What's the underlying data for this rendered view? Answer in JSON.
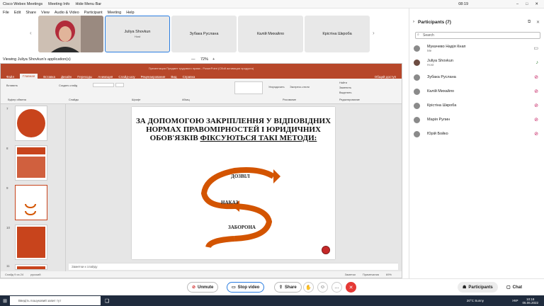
{
  "titlebar": {
    "app": "Cisco Webex Meetings",
    "info": "Meeting Info",
    "hide_menu": "Hide Menu Bar",
    "time": "08:19"
  },
  "menu": [
    "File",
    "Edit",
    "Share",
    "View",
    "Audio & Video",
    "Participant",
    "Meeting",
    "Help"
  ],
  "tiles": [
    {
      "name": "Juliya Shovkun",
      "role": "Host"
    },
    {
      "name": "Зубака Руслана"
    },
    {
      "name": "Калій Михайло"
    },
    {
      "name": "Крістіна Шкроба"
    }
  ],
  "viewing": {
    "label": "Viewing Juliya Shovkun's application(s)",
    "zoom": "72%"
  },
  "ppt": {
    "title": "Презентация Предмет трудового права - PowerPoint (Сбой активации продукта)",
    "tabs": [
      "Файл",
      "Главная",
      "Вставка",
      "Дизайн",
      "Переходы",
      "Анимация",
      "Слайд-шоу",
      "Рецензирование",
      "Вид",
      "Справка"
    ],
    "active_tab": "Главная",
    "ribbon_groups": [
      "Буфер обмена",
      "Слайды",
      "Шрифт",
      "Абзац",
      "Рисование",
      "Редактирование"
    ],
    "ribbon_buttons": [
      "Вставить",
      "Создать слайд",
      "Упорядочить",
      "Экспресс-стили",
      "Найти",
      "Заменить",
      "Выделить"
    ],
    "share_btn": "Общий доступ",
    "slide_numbers": [
      "7",
      "8",
      "9",
      "10",
      "11"
    ],
    "slide_title": "ЗА ДОПОМОГОЮ ЗАКРІПЛЕННЯ У ВІДПОВІДНИХ НОРМАХ ПРАВОМІРНОСТЕЙ І ЮРИДИЧНИХ ОБОВ'ЯЗКІВ",
    "slide_title_underlined": "ФІКСУЮТЬСЯ ТАКІ МЕТОДИ:",
    "labels": [
      "ДОЗВІЛ",
      "НАКАЗ",
      "ЗАБОРОНА"
    ],
    "notes": "Заметки к слайду",
    "status_left": "Слайд 9 из 24",
    "status_lang": "русский",
    "status_notes": "Заметки",
    "status_comments": "Примечания",
    "status_zoom": "69%"
  },
  "panel": {
    "title": "Participants (7)",
    "search": "Search",
    "participants": [
      {
        "name": "Мукачево Надія Кнап",
        "role": "Me"
      },
      {
        "name": "Juliya Shovkun",
        "role": "Host"
      },
      {
        "name": "Зубака Руслана"
      },
      {
        "name": "Калій Михайло"
      },
      {
        "name": "Крістіна Шкроба"
      },
      {
        "name": "Марія Рулин"
      },
      {
        "name": "Юрій Бойко"
      }
    ]
  },
  "controls": {
    "unmute": "Unmute",
    "stop_video": "Stop video",
    "share": "Share",
    "participants": "Participants",
    "chat": "Chat"
  },
  "taskbar": {
    "search": "Введіть пошуковий запит тут",
    "weather": "20°C Sunny",
    "lang": "УКР",
    "time": "10:18",
    "date": "05.06.2022"
  },
  "colors": {
    "ppt_red": "#b7472a",
    "arrow": "#d35400",
    "end_red": "#e53935"
  }
}
